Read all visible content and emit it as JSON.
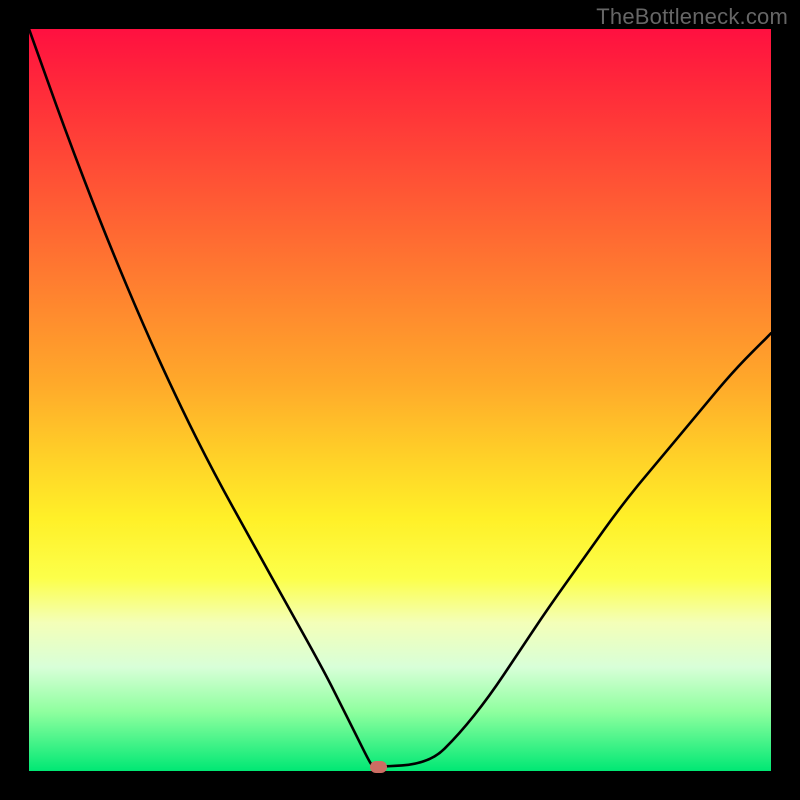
{
  "watermark": "TheBottleneck.com",
  "chart_data": {
    "type": "line",
    "title": "",
    "xlabel": "",
    "ylabel": "",
    "xlim": [
      0,
      100
    ],
    "ylim": [
      0,
      100
    ],
    "series": [
      {
        "name": "bottleneck-curve",
        "x": [
          0,
          5,
          10,
          15,
          20,
          25,
          30,
          35,
          40,
          42,
          44,
          46,
          46.5,
          54,
          58,
          62,
          66,
          70,
          75,
          80,
          85,
          90,
          95,
          100
        ],
        "values": [
          100,
          86,
          73,
          61,
          50,
          40,
          31,
          22,
          13,
          9,
          5,
          1,
          0.5,
          1,
          5,
          10,
          16,
          22,
          29,
          36,
          42,
          48,
          54,
          59
        ]
      }
    ],
    "marker": {
      "x": 47,
      "y": 0.5,
      "color": "#cc6d63"
    },
    "gradient_stops": [
      {
        "pos": 0,
        "color": "#ff1040"
      },
      {
        "pos": 50,
        "color": "#ffd228"
      },
      {
        "pos": 78,
        "color": "#f4ffb8"
      },
      {
        "pos": 100,
        "color": "#00e874"
      }
    ]
  }
}
